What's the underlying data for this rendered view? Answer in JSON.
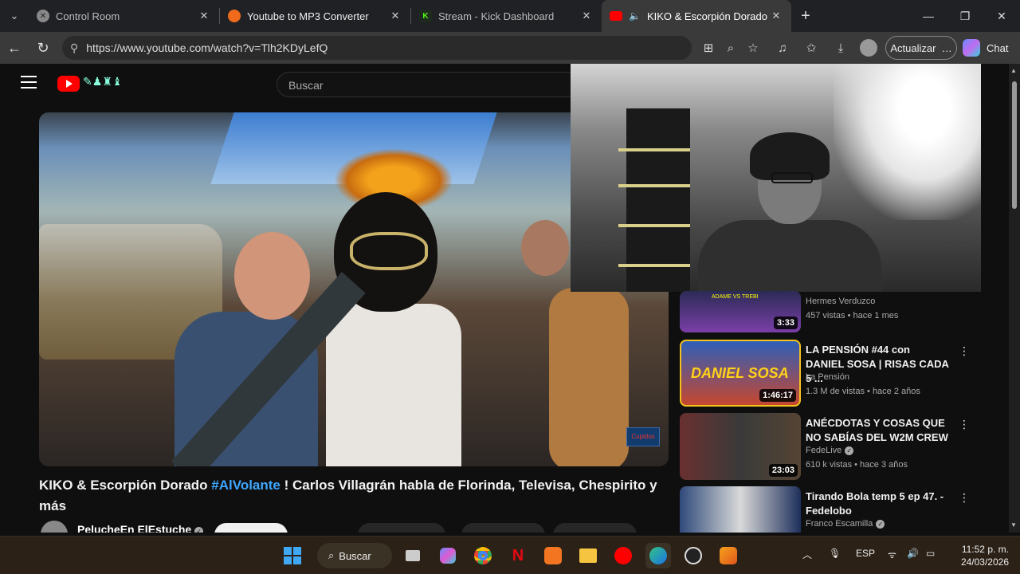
{
  "browser": {
    "tabs": [
      {
        "title": "Control Room",
        "icon": "globe-icon"
      },
      {
        "title": "Youtube to MP3 Converter",
        "icon": "converter-icon"
      },
      {
        "title": "Stream - Kick Dashboard",
        "icon": "kick-icon"
      },
      {
        "title": "KIKO & Escorpión Dorado #Al",
        "icon": "youtube-icon"
      }
    ],
    "url": "https://www.youtube.com/watch?v=Tlh2KDyLefQ",
    "update_label": "Actualizar",
    "chat_label": "Chat"
  },
  "youtube": {
    "search_placeholder": "Buscar",
    "video": {
      "title_part1": "KIKO & Escorpión Dorado ",
      "title_hashtag": "#AlVolante",
      "title_part2": " ! Carlos Villagrán habla de Florinda, Televisa, Chespirito y más",
      "channel": "PelucheEn ElEstuche",
      "watermark": "Cupidos"
    },
    "recommendations": [
      {
        "title": "",
        "channel": "Hermes Verduzco",
        "meta": "457 vistas • hace 1 mes",
        "duration": "3:33",
        "thumb_text": "ADAME VS TREBI"
      },
      {
        "title": "LA PENSIÓN #44 con DANIEL SOSA | RISAS CADA 5 ...",
        "channel": "La Pensión",
        "meta": "1.3 M de vistas • hace 2 años",
        "duration": "1:46:17",
        "thumb_text": "DANIEL SOSA"
      },
      {
        "title": "ANÉCDOTAS Y COSAS QUE NO SABÍAS DEL W2M CREW",
        "channel": "FedeLive",
        "meta": "610 k vistas • hace 3 años",
        "duration": "23:03",
        "thumb_text": ""
      },
      {
        "title": "Tirando Bola temp 5 ep 47. - Fedelobo",
        "channel": "Franco Escamilla",
        "meta": "",
        "duration": "",
        "thumb_text": ""
      }
    ]
  },
  "taskbar": {
    "search_label": "Buscar",
    "language": "ESP",
    "time": "11:52 p. m.",
    "date": "24/03/2026"
  }
}
